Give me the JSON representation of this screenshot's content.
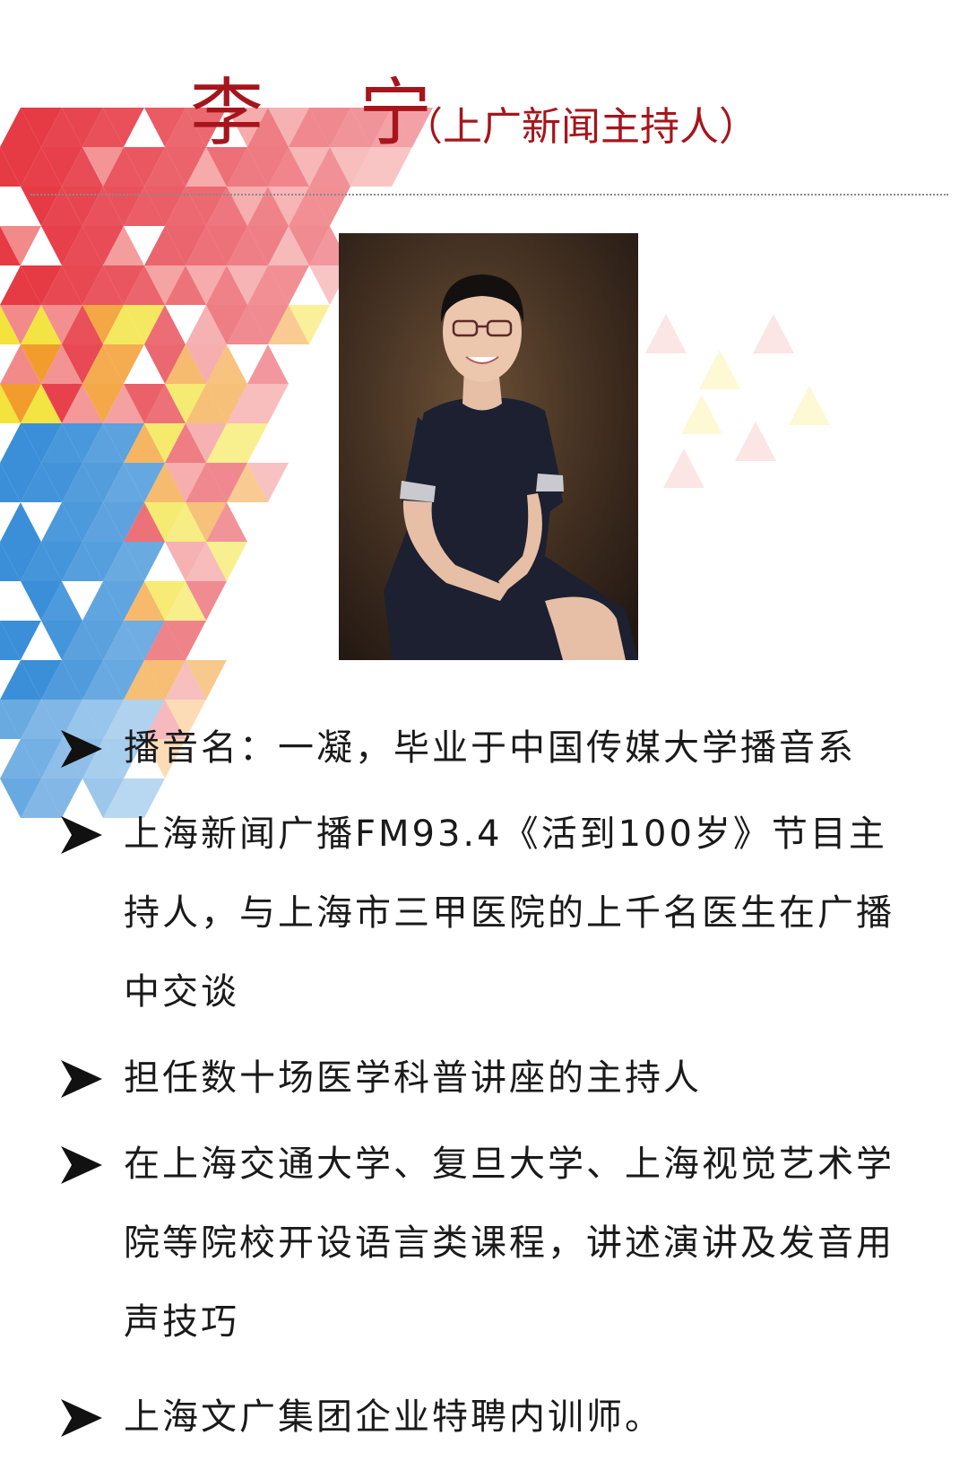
{
  "header": {
    "name": "李 宁",
    "subtitle": "（上广新闻主持人）"
  },
  "colors": {
    "title": "#a6151c",
    "text": "#1a1a1a",
    "triangle_red": "#e63a45",
    "triangle_orange": "#f39c2e",
    "triangle_yellow": "#f3e33c",
    "triangle_blue": "#3a8fd8",
    "triangle_pink": "#f28a8a"
  },
  "portrait": {
    "icon": "portrait-photo"
  },
  "bio": {
    "items": [
      "播音名：一凝，毕业于中国传媒大学播音系",
      "上海新闻广播FM93.4《活到100岁》节目主持人，与上海市三甲医院的上千名医生在广播中交谈",
      "担任数十场医学科普讲座的主持人",
      "在上海交通大学、复旦大学、上海视觉艺术学院等院校开设语言类课程，讲述演讲及发音用声技巧",
      "上海文广集团企业特聘内训师。"
    ]
  }
}
